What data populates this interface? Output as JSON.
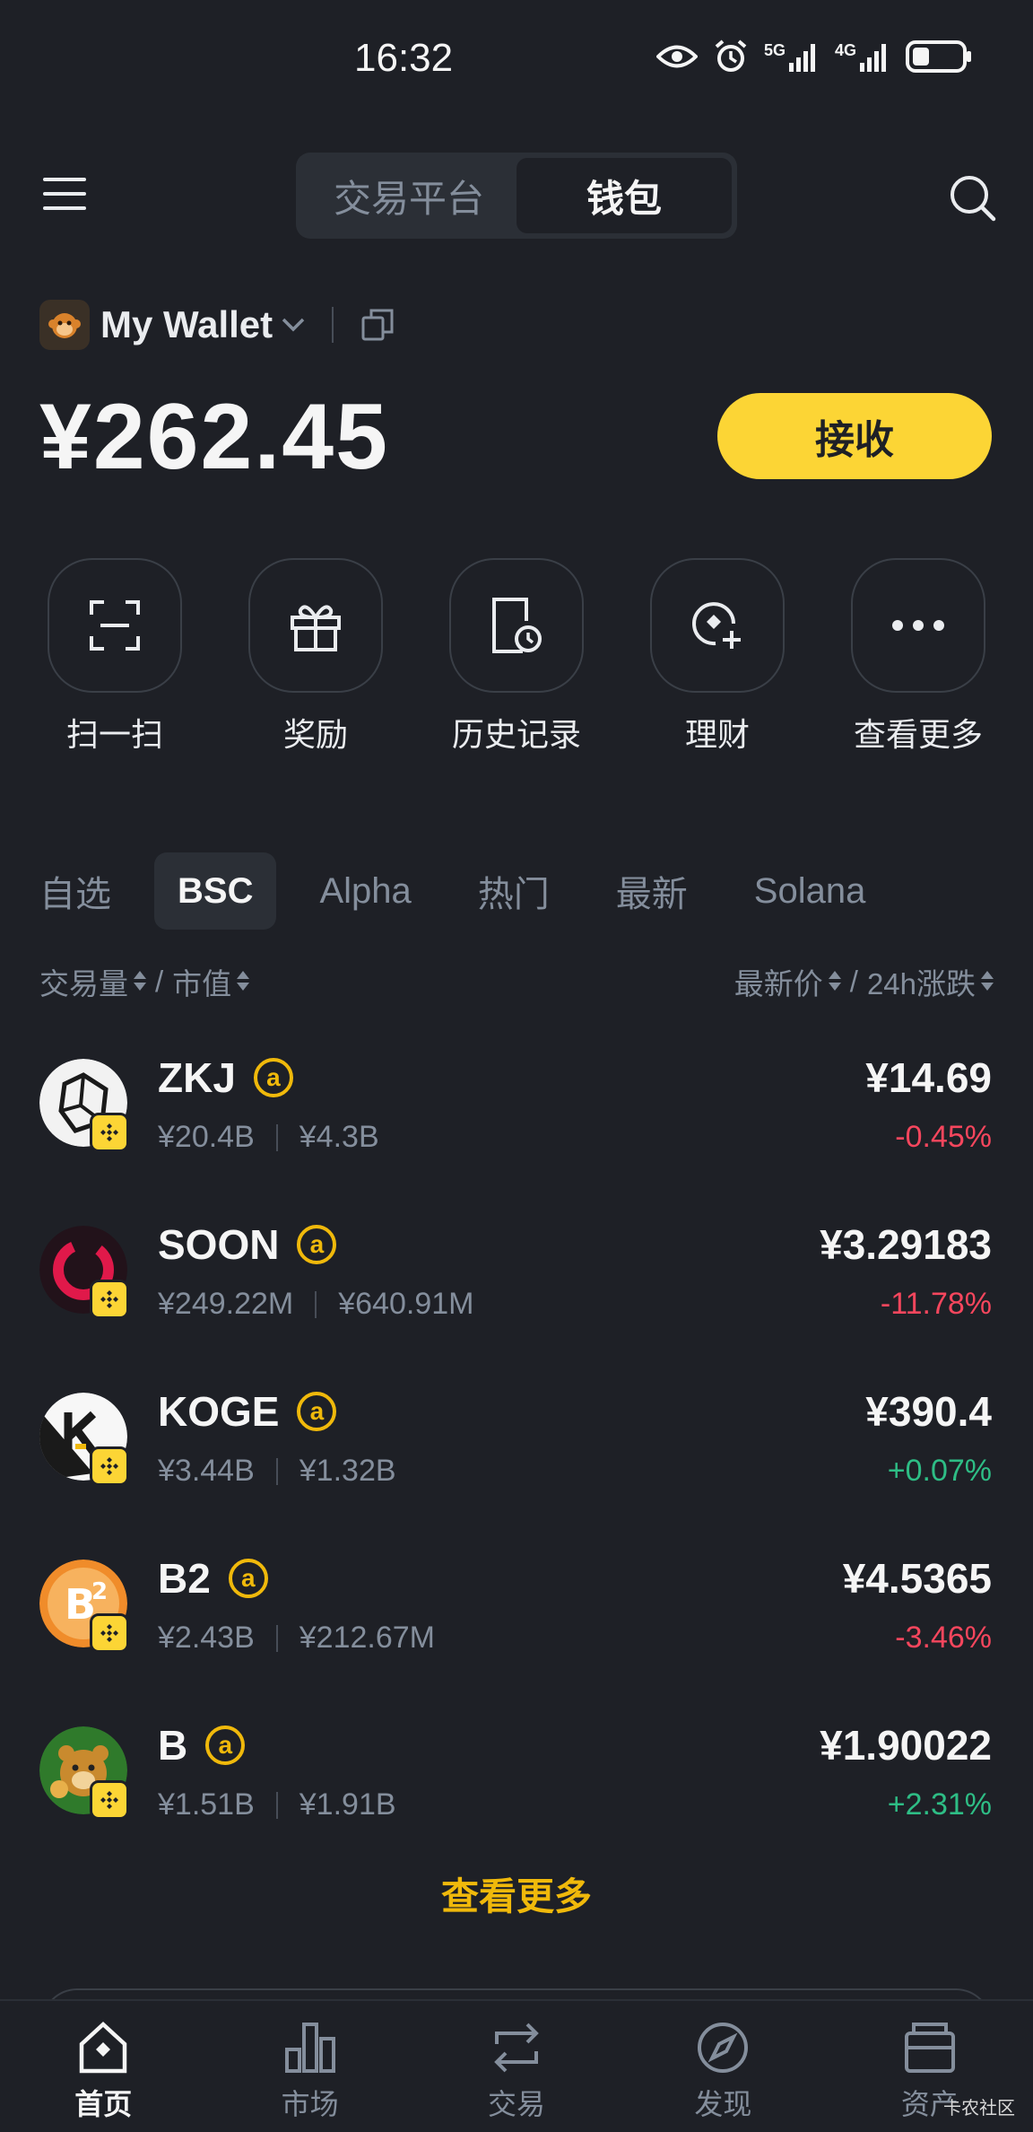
{
  "status_bar": {
    "time": "16:32",
    "net1": "5G",
    "net2": "4G"
  },
  "top_nav": {
    "tabs": [
      "交易平台",
      "钱包"
    ],
    "active_tab": 1
  },
  "wallet": {
    "name": "My Wallet",
    "balance": "¥262.45",
    "receive_label": "接收"
  },
  "actions": [
    {
      "label": "扫一扫",
      "icon": "scan-icon"
    },
    {
      "label": "奖励",
      "icon": "gift-icon"
    },
    {
      "label": "历史记录",
      "icon": "history-icon"
    },
    {
      "label": "理财",
      "icon": "earn-icon"
    },
    {
      "label": "查看更多",
      "icon": "more-icon"
    }
  ],
  "chain_tabs": [
    "自选",
    "BSC",
    "Alpha",
    "热门",
    "最新",
    "Solana"
  ],
  "chain_tab_active": 1,
  "sort": {
    "volume": "交易量",
    "sep1": "/",
    "mcap": "市值",
    "price": "最新价",
    "sep2": "/",
    "change": "24h涨跌"
  },
  "tokens": [
    {
      "symbol": "ZKJ",
      "volume": "¥20.4B",
      "mcap": "¥4.3B",
      "price": "¥14.69",
      "change": "-0.45%",
      "direction": "down"
    },
    {
      "symbol": "SOON",
      "volume": "¥249.22M",
      "mcap": "¥640.91M",
      "price": "¥3.29183",
      "change": "-11.78%",
      "direction": "down"
    },
    {
      "symbol": "KOGE",
      "volume": "¥3.44B",
      "mcap": "¥1.32B",
      "price": "¥390.4",
      "change": "+0.07%",
      "direction": "up"
    },
    {
      "symbol": "B2",
      "volume": "¥2.43B",
      "mcap": "¥212.67M",
      "price": "¥4.5365",
      "change": "-3.46%",
      "direction": "down"
    },
    {
      "symbol": "B",
      "volume": "¥1.51B",
      "mcap": "¥1.91B",
      "price": "¥1.90022",
      "change": "+2.31%",
      "direction": "up"
    }
  ],
  "see_more": "查看更多",
  "bottom_nav": [
    {
      "label": "首页",
      "icon": "home-icon"
    },
    {
      "label": "市场",
      "icon": "market-icon"
    },
    {
      "label": "交易",
      "icon": "trade-icon"
    },
    {
      "label": "发现",
      "icon": "discover-icon"
    },
    {
      "label": "资产",
      "icon": "assets-icon"
    }
  ],
  "bottom_nav_active": 0,
  "watermark": "卡农社区",
  "colors": {
    "accent": "#fcd535",
    "negative": "#f6465d",
    "positive": "#2ebd85",
    "background": "#1e2026"
  }
}
